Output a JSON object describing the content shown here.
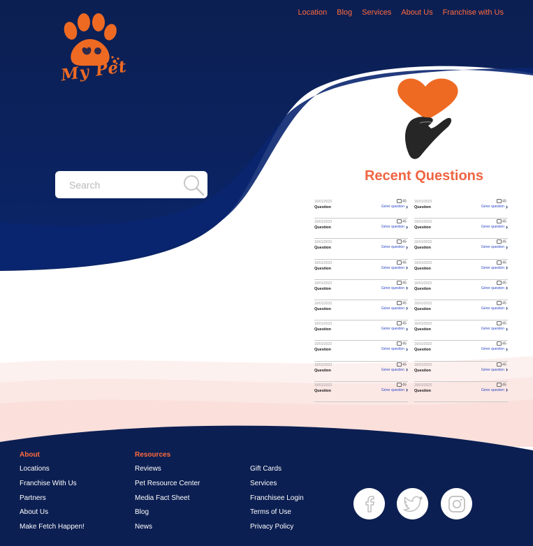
{
  "nav": [
    "Location",
    "Blog",
    "Services",
    "About Us",
    "Franchise with Us"
  ],
  "logo": {
    "text": "My Pet"
  },
  "search": {
    "placeholder": "Search"
  },
  "recent": {
    "title": "Recent Questions",
    "items": [
      {
        "date": "16/01/2023",
        "count": "45",
        "label": "Question",
        "action": "Gérer question"
      },
      {
        "date": "16/01/2023",
        "count": "45",
        "label": "Question",
        "action": "Gérer question"
      },
      {
        "date": "16/01/2023",
        "count": "45",
        "label": "Question",
        "action": "Gérer question"
      },
      {
        "date": "16/01/2023",
        "count": "45",
        "label": "Question",
        "action": "Gérer question"
      },
      {
        "date": "16/01/2023",
        "count": "45",
        "label": "Question",
        "action": "Gérer question"
      },
      {
        "date": "16/01/2023",
        "count": "45",
        "label": "Question",
        "action": "Gérer question"
      },
      {
        "date": "16/01/2023",
        "count": "45",
        "label": "Question",
        "action": "Gérer question"
      },
      {
        "date": "16/01/2023",
        "count": "45",
        "label": "Question",
        "action": "Gérer question"
      },
      {
        "date": "16/01/2023",
        "count": "45",
        "label": "Question",
        "action": "Gérer question"
      },
      {
        "date": "16/01/2023",
        "count": "45",
        "label": "Question",
        "action": "Gérer question"
      },
      {
        "date": "16/01/2023",
        "count": "45",
        "label": "Question",
        "action": "Gérer question"
      },
      {
        "date": "16/01/2023",
        "count": "45",
        "label": "Question",
        "action": "Gérer question"
      },
      {
        "date": "16/01/2023",
        "count": "45",
        "label": "Question",
        "action": "Gérer question"
      },
      {
        "date": "16/01/2023",
        "count": "45",
        "label": "Question",
        "action": "Gérer question"
      },
      {
        "date": "16/01/2023",
        "count": "45",
        "label": "Question",
        "action": "Gérer question"
      },
      {
        "date": "16/01/2023",
        "count": "45",
        "label": "Question",
        "action": "Gérer question"
      },
      {
        "date": "16/01/2023",
        "count": "45",
        "label": "Question",
        "action": "Gérer question"
      },
      {
        "date": "16/01/2023",
        "count": "45",
        "label": "Question",
        "action": "Gérer question"
      },
      {
        "date": "16/01/2023",
        "count": "45",
        "label": "Question",
        "action": "Gérer question"
      },
      {
        "date": "16/01/2023",
        "count": "45",
        "label": "Question",
        "action": "Gérer question"
      }
    ]
  },
  "footer": {
    "about": {
      "heading": "About",
      "items": [
        "Locations",
        "Franchise With Us",
        "Partners",
        "About Us",
        "Make Fetch Happen!"
      ]
    },
    "resources": {
      "heading": "Resources",
      "items": [
        "Reviews",
        "Pet Resource Center",
        "Media Fact Sheet",
        "Blog",
        "News"
      ]
    },
    "more": {
      "items": [
        "Gift Cards",
        "Services",
        "Franchisee Login",
        "Terms of Use",
        "Privacy Policy"
      ]
    },
    "social": [
      "facebook-icon",
      "twitter-icon",
      "instagram-icon"
    ]
  },
  "colors": {
    "navy": "#0d2359",
    "navy_mid": "#0b2871",
    "accent": "#ff6a3d",
    "title": "#ef6442",
    "logo": "#ee6a23",
    "link_blue": "#2d49c7"
  }
}
